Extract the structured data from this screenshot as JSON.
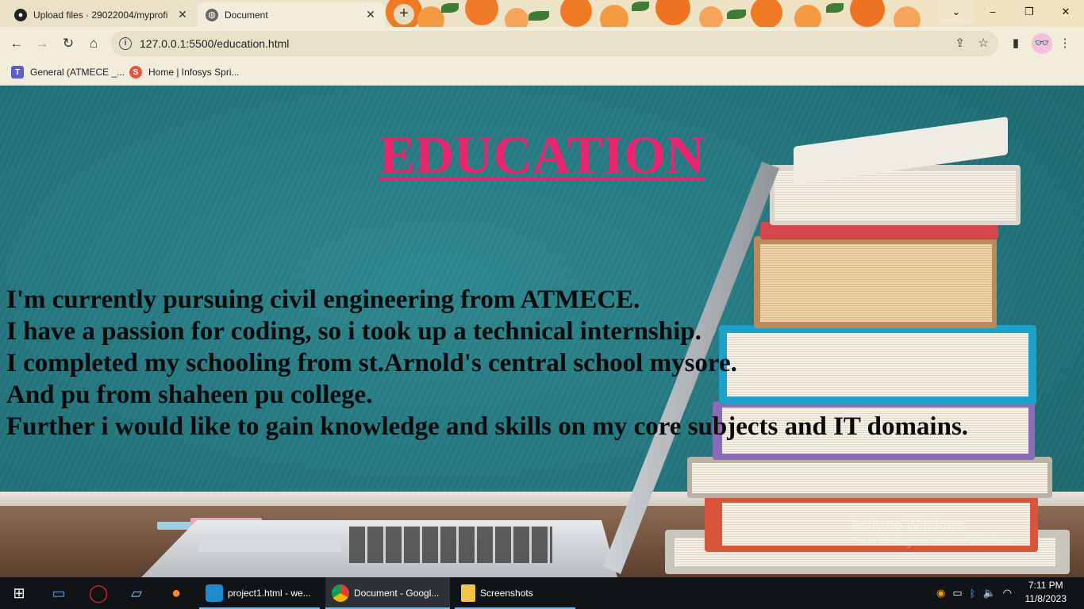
{
  "browser": {
    "tabs": [
      {
        "title": "Upload files · 29022004/myprofi",
        "icon": "github-icon",
        "active": false
      },
      {
        "title": "Document",
        "icon": "globe-icon",
        "active": true
      }
    ],
    "new_tab_label": "+",
    "window_controls": {
      "minimize": "–",
      "restore": "❐",
      "close": "✕",
      "dropdown": "⌄"
    },
    "url": "127.0.0.1:5500/education.html",
    "bookmarks": [
      {
        "label": "General (ATMECE _...",
        "icon": "teams-icon"
      },
      {
        "label": "Home | Infosys Spri...",
        "icon": "infosys-icon"
      }
    ]
  },
  "page": {
    "heading": "EDUCATION",
    "heading_color": "#e8266e",
    "paragraph_lines": [
      "I'm currently pursuing civil engineering from ATMECE.",
      "I have a passion for coding, so i took up a technical internship.",
      "I completed my schooling from st.Arnold's central school mysore.",
      "And pu from shaheen pu college.",
      "Further i would like to gain knowledge and skills on my core subjects and IT domains."
    ],
    "watermark_title": "Activate Windows",
    "watermark_subtitle": "Go to Settings to activate Windows."
  },
  "taskbar": {
    "apps": [
      {
        "label": "project1.html - we...",
        "icon": "vscode-icon",
        "active": false
      },
      {
        "label": "Document - Googl...",
        "icon": "chrome-icon",
        "active": true
      },
      {
        "label": "Screenshots",
        "icon": "folder-icon",
        "active": false
      }
    ],
    "time": "7:11 PM",
    "date": "11/8/2023"
  }
}
